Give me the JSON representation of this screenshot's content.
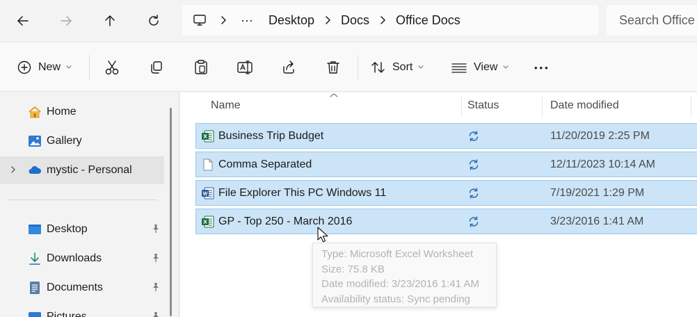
{
  "address_bar": {
    "breadcrumbs": [
      "Desktop",
      "Docs",
      "Office Docs"
    ],
    "overflow": "···",
    "search_placeholder": "Search Office Docs"
  },
  "command_bar": {
    "new_label": "New",
    "sort_label": "Sort",
    "view_label": "View",
    "more_label": "•••"
  },
  "sidebar": {
    "items": [
      {
        "label": "Home",
        "icon": "home-icon"
      },
      {
        "label": "Gallery",
        "icon": "gallery-icon"
      },
      {
        "label": "mystic - Personal",
        "icon": "onedrive-cloud-icon"
      }
    ],
    "quick_access": [
      {
        "label": "Desktop",
        "icon": "desktop-folder-icon"
      },
      {
        "label": "Downloads",
        "icon": "downloads-icon"
      },
      {
        "label": "Documents",
        "icon": "documents-icon"
      },
      {
        "label": "Pictures",
        "icon": "pictures-icon"
      }
    ]
  },
  "file_list": {
    "columns": [
      "Name",
      "Status",
      "Date modified"
    ],
    "rows": [
      {
        "name": "Business Trip Budget",
        "type": "excel",
        "date": "11/20/2019 2:25 PM"
      },
      {
        "name": "Comma Separated",
        "type": "generic",
        "date": "12/11/2023 10:14 AM"
      },
      {
        "name": "File Explorer This PC Windows 11",
        "type": "word",
        "date": "7/19/2021 1:29 PM"
      },
      {
        "name": "GP - Top 250 - March 2016",
        "type": "excel",
        "date": "3/23/2016 1:41 AM"
      }
    ]
  },
  "tooltip": {
    "type_line": "Type: Microsoft Excel Worksheet",
    "size_line": "Size: 75.8 KB",
    "date_line": "Date modified: 3/23/2016 1:41 AM",
    "availability_line": "Availability status: Sync pending"
  },
  "colors": {
    "selection": "#cce4f7",
    "selection_border": "#99c9ef",
    "sync_blue": "#2f6fb3",
    "excel_green": "#1e7145",
    "word_blue": "#2b5797"
  }
}
